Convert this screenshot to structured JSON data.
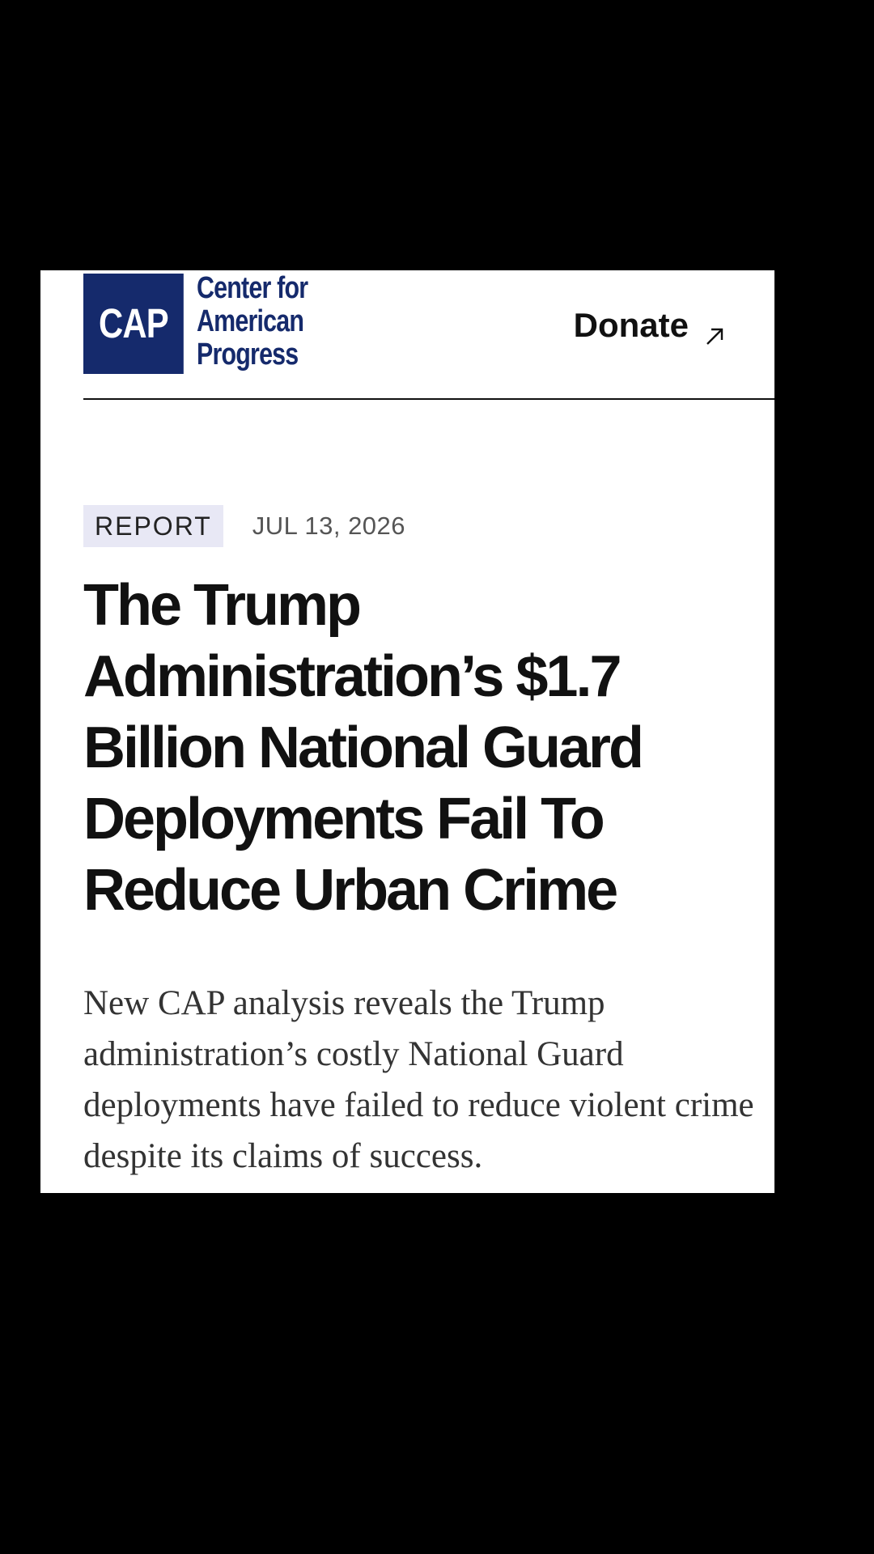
{
  "logo": {
    "mark": "CAP",
    "words": [
      "Center for",
      "American",
      "Progress"
    ],
    "brand_color": "#152a6c"
  },
  "header": {
    "donate_label": "Donate",
    "donate_icon": "arrow-up-right-icon"
  },
  "article": {
    "category": "REPORT",
    "date": "JUL 13, 2026",
    "title": "The Trump Administration’s $1.7 Billion National Guard Deployments Fail To Reduce Urban Crime",
    "summary": "New CAP analysis reveals the Trump administration’s costly National Guard deployments have failed to reduce violent crime despite its claims of success."
  }
}
